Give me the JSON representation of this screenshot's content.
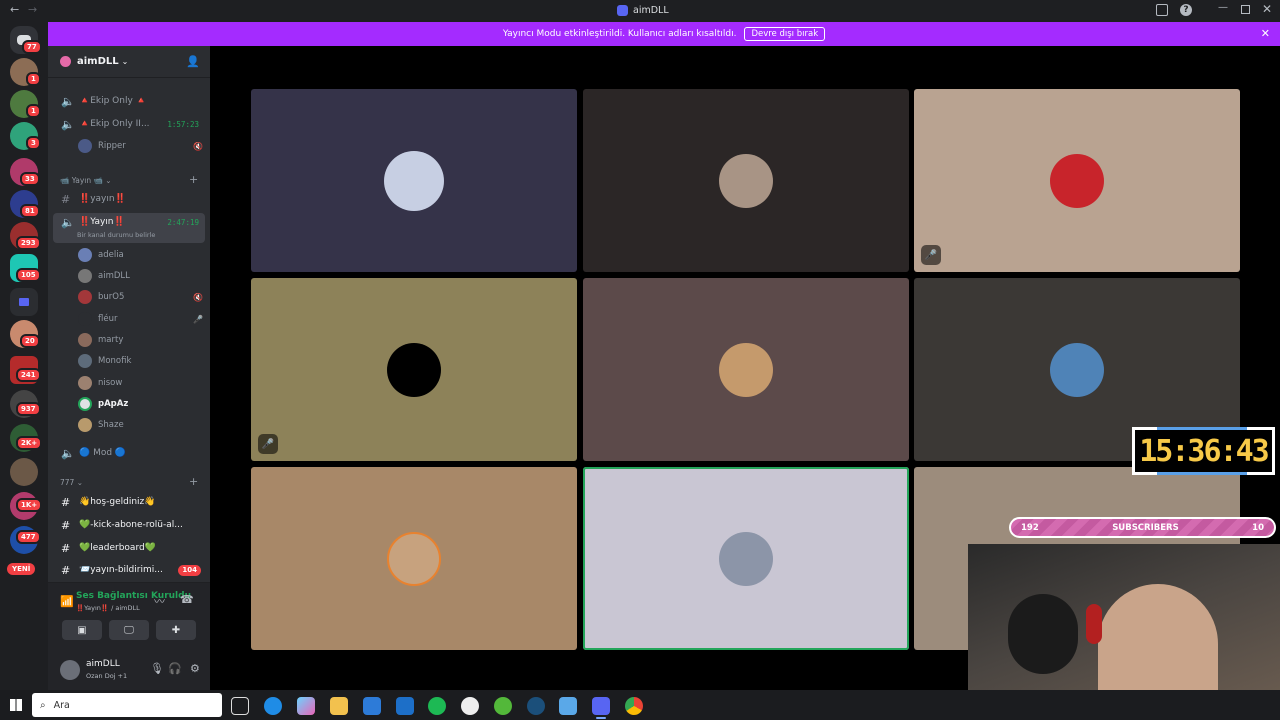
{
  "window": {
    "title": "aimDLL"
  },
  "banner": {
    "text": "Yayıncı Modu etkinleştirildi. Kullanıcı adları kısaltıldı.",
    "button_label": "Devre dışı bırak"
  },
  "server_badges": [
    "77",
    "1",
    "1",
    "3",
    "33",
    "81",
    "293",
    "105",
    "20",
    "241",
    "937",
    "2K+",
    "1K+",
    "477"
  ],
  "server_new_label": "YENİ",
  "server": {
    "name": "aimDLL"
  },
  "channels": {
    "ekip_only": "🔺Ekip Only 🔺",
    "ekip_only2": "🔺Ekip Only II...",
    "ekip_only2_timer": "1:57:23",
    "ripper": "Ripper",
    "cat_yayin": "📹 Yayın 📹",
    "yayin_text": "‼️yayın‼️",
    "yayin_voice": "‼️Yayın‼️",
    "yayin_voice_timer": "2:47:19",
    "yayin_status": "Bir kanal durumu belirle",
    "members": [
      "adelia",
      "aimDLL",
      "burO5",
      "fléur",
      "marty",
      "Monofik",
      "nisow",
      "pApAz",
      "Shaze"
    ],
    "mod": "🔵 Mod 🔵",
    "cat_777": "777",
    "text_channels": [
      "👋hoş-geldiniz👋",
      "💚-kick-abone-rolü-al...",
      "💚leaderboard💚",
      "📨yayın-bildirimi..."
    ],
    "notif_badge": "104"
  },
  "voice_panel": {
    "status": "Ses Bağlantısı Kuruldu",
    "location": "‼️Yayın‼️ / aimDLL"
  },
  "user_panel": {
    "name": "aimDLL",
    "status": "Ozan Doj +1"
  },
  "overlay": {
    "clock": "15:36:43",
    "sub_left": "192",
    "sub_label": "SUBSCRIBERS",
    "sub_right": "10"
  },
  "taskbar": {
    "search_placeholder": "Ara"
  },
  "colors": {
    "banner": "#a42bff",
    "speaking": "#23a55a"
  }
}
